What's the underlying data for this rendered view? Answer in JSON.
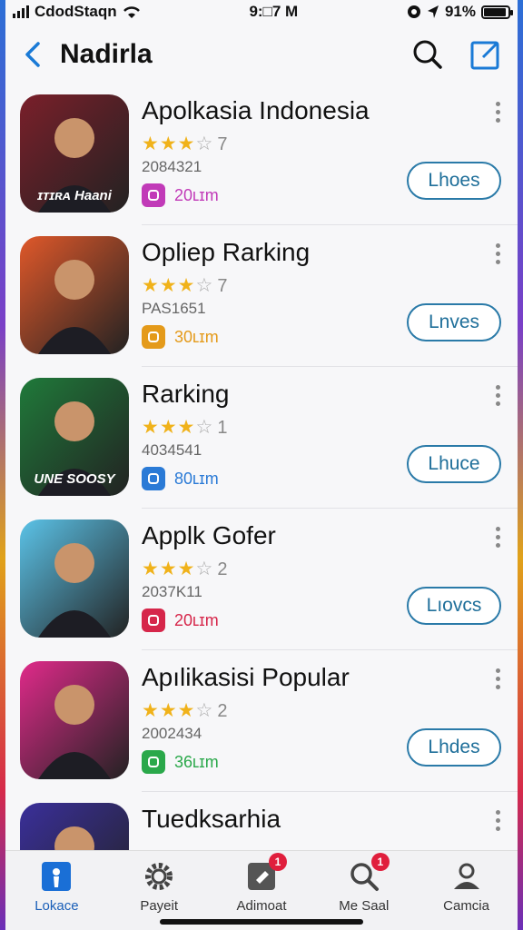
{
  "status": {
    "carrier": "CdodStaqn",
    "time": "9:□7 M",
    "battery": "91%",
    "battery_level": 0.91
  },
  "nav": {
    "title": "Nadirla"
  },
  "apps": [
    {
      "name": "Apolkasia Indonesia",
      "rating": 3,
      "rating_count": "7",
      "downloads": "2084321",
      "size": "20ʟɪm",
      "size_color": "#c13ab8",
      "button": "Lhoes",
      "icon_text": "ɪᴛɪʀᴀ Haani",
      "icon_bg": "#7a1f2a"
    },
    {
      "name": "Opliep Rarking",
      "rating": 3,
      "rating_count": "7",
      "downloads": "PAS1651",
      "size": "30ʟɪm",
      "size_color": "#e49a1a",
      "button": "Lnves",
      "icon_text": "",
      "icon_bg": "#e0582a"
    },
    {
      "name": "Rarking",
      "rating": 3,
      "rating_count": "1",
      "downloads": "4034541",
      "size": "80ʟɪm",
      "size_color": "#2a7ad6",
      "button": "Lhuce",
      "icon_text": "UNE SOOSY",
      "icon_bg": "#1f7a3a"
    },
    {
      "name": "Applk Gofer",
      "rating": 3,
      "rating_count": "2",
      "downloads": "2037K11",
      "size": "20ʟɪm",
      "size_color": "#d6264a",
      "button": "Lıovcs",
      "icon_text": "",
      "icon_bg": "#5bc3e8"
    },
    {
      "name": "Apılikasisi Popular",
      "rating": 3,
      "rating_count": "2",
      "downloads": "2002434",
      "size": "36ʟɪm",
      "size_color": "#2aa84a",
      "button": "Lhdes",
      "icon_text": "",
      "icon_bg": "#e02a8a"
    },
    {
      "name": "Tuedksarhia",
      "rating": 0,
      "rating_count": "",
      "downloads": "",
      "size": "",
      "size_color": "#888888",
      "button": "",
      "icon_text": "",
      "icon_bg": "#3a2f9a"
    }
  ],
  "tabs": [
    {
      "label": "Lokace",
      "icon": "location-icon",
      "badge": ""
    },
    {
      "label": "Payeit",
      "icon": "gear-icon",
      "badge": ""
    },
    {
      "label": "Adimoat",
      "icon": "tag-icon",
      "badge": "1"
    },
    {
      "label": "Me Saal",
      "icon": "search-icon",
      "badge": "1"
    },
    {
      "label": "Camcia",
      "icon": "person-icon",
      "badge": ""
    }
  ]
}
